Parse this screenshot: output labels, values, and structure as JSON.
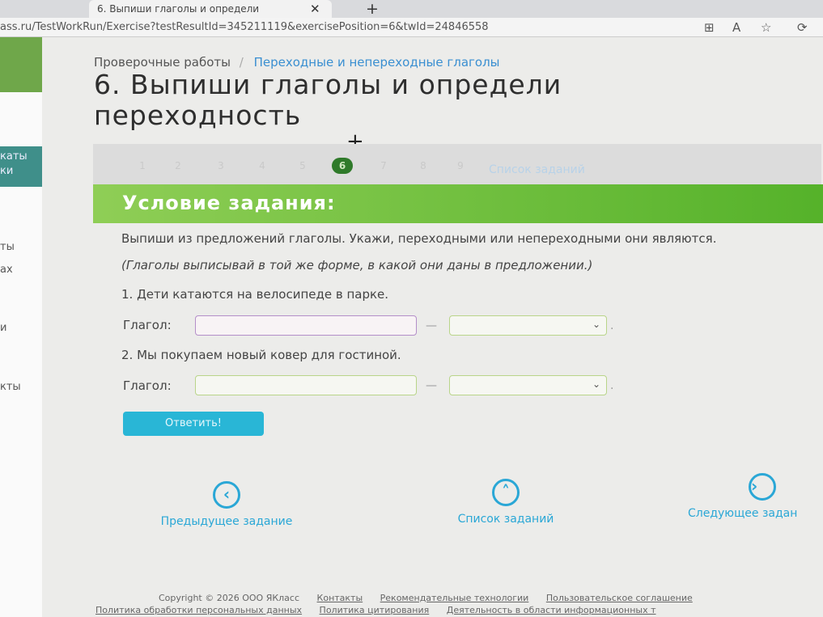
{
  "browser": {
    "tab_title": "6. Выпиши глаголы и определи",
    "tab_close": "✕",
    "tab_new": "+",
    "url": "ass.ru/TestWorkRun/Exercise?testResultId=345211119&exercisePosition=6&twId=24846558",
    "icons": [
      "reader-icon",
      "read-aloud-icon",
      "favorite-icon",
      "extensions-icon"
    ]
  },
  "sidebar": {
    "items": [
      "каты",
      "ки",
      "ты",
      "ах",
      "и",
      "кты"
    ]
  },
  "breadcrumb": {
    "root": "Проверочные работы",
    "separator": "/",
    "current": "Переходные и непереходные глаголы"
  },
  "page_title": "6. Выпиши глаголы и определи переходность",
  "pager": {
    "pages": [
      "1",
      "2",
      "3",
      "4",
      "5",
      "6",
      "7",
      "8",
      "9"
    ],
    "active": "6",
    "list_label": "Список заданий"
  },
  "condition": {
    "heading": "Условие задания:",
    "instruction": "Выпиши из предложений глаголы. Укажи, переходными или непереходными они являются.",
    "note": "(Глаголы выписывай в той же форме, в какой они даны в предложении.)"
  },
  "questions": [
    {
      "sentence": "1. Дети катаются на велосипеде в парке.",
      "label": "Глагол:",
      "dash": "—",
      "end": "."
    },
    {
      "sentence": "2. Мы покупаем новый ковер для гостиной.",
      "label": "Глагол:",
      "dash": "—",
      "end": "."
    }
  ],
  "answer_button": "Ответить!",
  "navigation": {
    "prev": "Предыдущее задание",
    "list": "Список заданий",
    "next": "Следующее задан"
  },
  "footer": {
    "copyright": "Copyright © 2026 ООО ЯКласс",
    "contacts": "Контакты",
    "recommend": "Рекомендательные технологии",
    "agreement": "Пользовательское соглашение",
    "personal": "Политика обработки персональных данных",
    "citation": "Политика цитирования",
    "activity": "Деятельность в области информационных т"
  },
  "colors": {
    "accent_green": "#55b22a",
    "link_blue": "#2aa7d6",
    "button": "#29b6d6"
  }
}
